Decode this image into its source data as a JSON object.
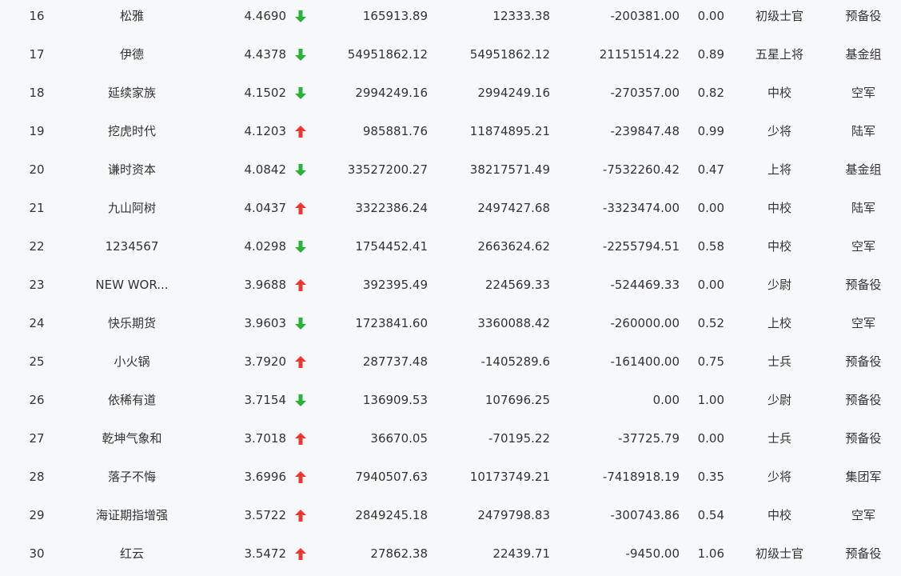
{
  "colors": {
    "up": "#e53935",
    "down": "#2eaf3a",
    "text": "#333333",
    "background": "#f7f8fa"
  },
  "rows": [
    {
      "rank": "16",
      "name": "松雅",
      "score": "4.4690",
      "trend": "down",
      "v1": "165913.89",
      "v2": "12333.38",
      "v3": "-200381.00",
      "ratio": "0.00",
      "rank_title": "初级士官",
      "branch": "预备役"
    },
    {
      "rank": "17",
      "name": "伊德",
      "score": "4.4378",
      "trend": "down",
      "v1": "54951862.12",
      "v2": "54951862.12",
      "v3": "21151514.22",
      "ratio": "0.89",
      "rank_title": "五星上将",
      "branch": "基金组"
    },
    {
      "rank": "18",
      "name": "延续家族",
      "score": "4.1502",
      "trend": "down",
      "v1": "2994249.16",
      "v2": "2994249.16",
      "v3": "-270357.00",
      "ratio": "0.82",
      "rank_title": "中校",
      "branch": "空军"
    },
    {
      "rank": "19",
      "name": "挖虎时代",
      "score": "4.1203",
      "trend": "up",
      "v1": "985881.76",
      "v2": "11874895.21",
      "v3": "-239847.48",
      "ratio": "0.99",
      "rank_title": "少将",
      "branch": "陆军"
    },
    {
      "rank": "20",
      "name": "谦时资本",
      "score": "4.0842",
      "trend": "down",
      "v1": "33527200.27",
      "v2": "38217571.49",
      "v3": "-7532260.42",
      "ratio": "0.47",
      "rank_title": "上将",
      "branch": "基金组"
    },
    {
      "rank": "21",
      "name": "九山阿树",
      "score": "4.0437",
      "trend": "up",
      "v1": "3322386.24",
      "v2": "2497427.68",
      "v3": "-3323474.00",
      "ratio": "0.00",
      "rank_title": "中校",
      "branch": "陆军"
    },
    {
      "rank": "22",
      "name": "1234567",
      "score": "4.0298",
      "trend": "down",
      "v1": "1754452.41",
      "v2": "2663624.62",
      "v3": "-2255794.51",
      "ratio": "0.58",
      "rank_title": "中校",
      "branch": "空军"
    },
    {
      "rank": "23",
      "name": "NEW WOR...",
      "score": "3.9688",
      "trend": "up",
      "v1": "392395.49",
      "v2": "224569.33",
      "v3": "-524469.33",
      "ratio": "0.00",
      "rank_title": "少尉",
      "branch": "预备役"
    },
    {
      "rank": "24",
      "name": "快乐期货",
      "score": "3.9603",
      "trend": "down",
      "v1": "1723841.60",
      "v2": "3360088.42",
      "v3": "-260000.00",
      "ratio": "0.52",
      "rank_title": "上校",
      "branch": "空军"
    },
    {
      "rank": "25",
      "name": "小火锅",
      "score": "3.7920",
      "trend": "up",
      "v1": "287737.48",
      "v2": "-1405289.6",
      "v3": "-161400.00",
      "ratio": "0.75",
      "rank_title": "士兵",
      "branch": "预备役"
    },
    {
      "rank": "26",
      "name": "依稀有道",
      "score": "3.7154",
      "trend": "down",
      "v1": "136909.53",
      "v2": "107696.25",
      "v3": "0.00",
      "ratio": "1.00",
      "rank_title": "少尉",
      "branch": "预备役"
    },
    {
      "rank": "27",
      "name": "乾坤气象和",
      "score": "3.7018",
      "trend": "up",
      "v1": "36670.05",
      "v2": "-70195.22",
      "v3": "-37725.79",
      "ratio": "0.00",
      "rank_title": "士兵",
      "branch": "预备役"
    },
    {
      "rank": "28",
      "name": "落子不悔",
      "score": "3.6996",
      "trend": "up",
      "v1": "7940507.63",
      "v2": "10173749.21",
      "v3": "-7418918.19",
      "ratio": "0.35",
      "rank_title": "少将",
      "branch": "集团军"
    },
    {
      "rank": "29",
      "name": "海证期指增强",
      "score": "3.5722",
      "trend": "up",
      "v1": "2849245.18",
      "v2": "2479798.83",
      "v3": "-300743.86",
      "ratio": "0.54",
      "rank_title": "中校",
      "branch": "空军"
    },
    {
      "rank": "30",
      "name": "红云",
      "score": "3.5472",
      "trend": "up",
      "v1": "27862.38",
      "v2": "22439.71",
      "v3": "-9450.00",
      "ratio": "1.06",
      "rank_title": "初级士官",
      "branch": "预备役"
    }
  ]
}
